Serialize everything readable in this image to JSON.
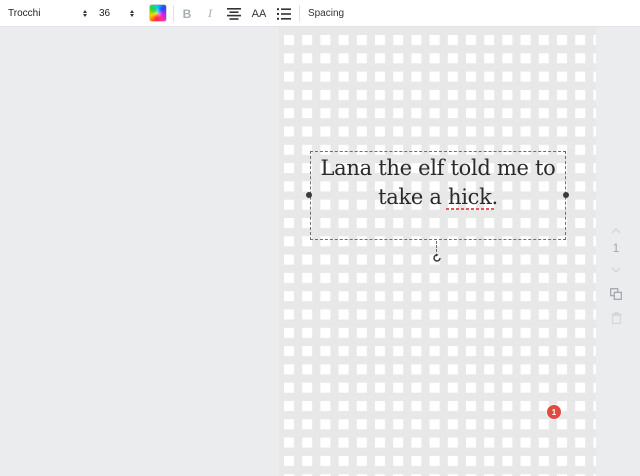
{
  "toolbar": {
    "font_family": "Trocchi",
    "font_size": "36",
    "bold_label": "B",
    "italic_label": "I",
    "case_label": "AA",
    "spacing_label": "Spacing",
    "icons": {
      "color": "rainbow-color-swatch-icon",
      "align": "align-center-icon",
      "list": "bulleted-list-icon"
    }
  },
  "canvas": {
    "text_lines": [
      "Lana the elf told me to",
      "take a hick."
    ],
    "pattern_colors": {
      "square": "#ffffff",
      "background": "#e8e8e9"
    }
  },
  "page_controls": {
    "page_number": "1",
    "icons": [
      "chevron-up-icon",
      "chevron-down-icon",
      "copy-page-icon",
      "trash-icon"
    ]
  },
  "notification": {
    "count": "1",
    "color": "#e14a43"
  }
}
